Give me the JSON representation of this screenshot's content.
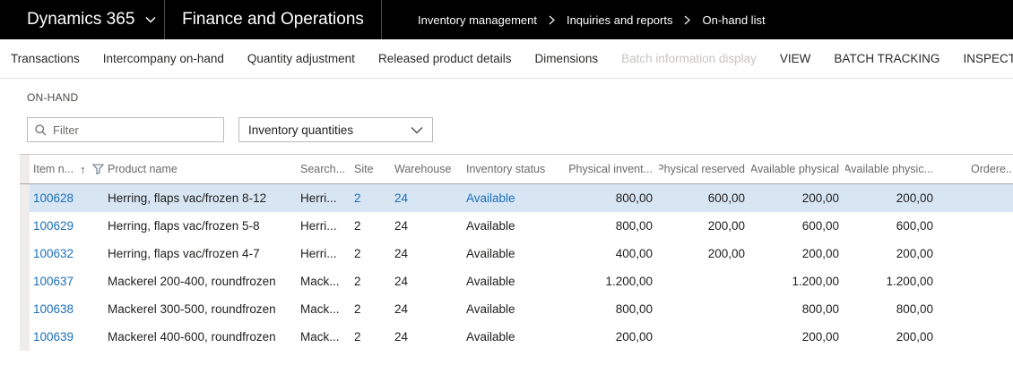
{
  "topbar": {
    "brand": "Dynamics 365",
    "app": "Finance and Operations",
    "breadcrumb": [
      "Inventory management",
      "Inquiries and reports",
      "On-hand list"
    ]
  },
  "menubar": {
    "items": [
      {
        "label": "Transactions",
        "disabled": false
      },
      {
        "label": "Intercompany on-hand",
        "disabled": false
      },
      {
        "label": "Quantity adjustment",
        "disabled": false
      },
      {
        "label": "Released product details",
        "disabled": false
      },
      {
        "label": "Dimensions",
        "disabled": false
      },
      {
        "label": "Batch information display",
        "disabled": true
      },
      {
        "label": "VIEW",
        "disabled": false
      },
      {
        "label": "BATCH TRACKING",
        "disabled": false
      },
      {
        "label": "INSPECT",
        "disabled": false
      }
    ]
  },
  "onhand": {
    "section_label": "ON-HAND",
    "filter_placeholder": "Filter",
    "view_selector_value": "Inventory quantities"
  },
  "icons": {
    "sort_ascending": "↑"
  },
  "grid": {
    "columns": [
      "Item n...",
      "Product name",
      "Search...",
      "Site",
      "Warehouse",
      "Inventory status",
      "Physical invent...",
      "Physical reserved",
      "Available physical",
      "Available physic...",
      "Ordere..."
    ],
    "rows": [
      {
        "item": "100628",
        "product": "Herring, flaps vac/frozen 8-12",
        "search": "Herri...",
        "site": "2",
        "warehouse": "24",
        "status": "Available",
        "physical_inventory": "800,00",
        "physical_reserved": "600,00",
        "available_physical": "200,00",
        "available_physical_2": "200,00",
        "ordered": ""
      },
      {
        "item": "100629",
        "product": "Herring, flaps vac/frozen 5-8",
        "search": "Herri...",
        "site": "2",
        "warehouse": "24",
        "status": "Available",
        "physical_inventory": "800,00",
        "physical_reserved": "200,00",
        "available_physical": "600,00",
        "available_physical_2": "600,00",
        "ordered": ""
      },
      {
        "item": "100632",
        "product": "Herring, flaps vac/frozen 4-7",
        "search": "Herri...",
        "site": "2",
        "warehouse": "24",
        "status": "Available",
        "physical_inventory": "400,00",
        "physical_reserved": "200,00",
        "available_physical": "200,00",
        "available_physical_2": "200,00",
        "ordered": ""
      },
      {
        "item": "100637",
        "product": "Mackerel 200-400, roundfrozen",
        "search": "Mack...",
        "site": "2",
        "warehouse": "24",
        "status": "Available",
        "physical_inventory": "1.200,00",
        "physical_reserved": "",
        "available_physical": "1.200,00",
        "available_physical_2": "1.200,00",
        "ordered": ""
      },
      {
        "item": "100638",
        "product": "Mackerel 300-500, roundfrozen",
        "search": "Mack...",
        "site": "2",
        "warehouse": "24",
        "status": "Available",
        "physical_inventory": "800,00",
        "physical_reserved": "",
        "available_physical": "800,00",
        "available_physical_2": "800,00",
        "ordered": ""
      },
      {
        "item": "100639",
        "product": "Mackerel 400-600, roundfrozen",
        "search": "Mack...",
        "site": "2",
        "warehouse": "24",
        "status": "Available",
        "physical_inventory": "200,00",
        "physical_reserved": "",
        "available_physical": "200,00",
        "available_physical_2": "200,00",
        "ordered": ""
      }
    ],
    "selected_row_index": 0
  },
  "colors": {
    "topbar_bg": "#000000",
    "link_blue": "#1a6fba",
    "selected_row_bg": "#d8e6f4",
    "disabled_text": "#c6c4c2"
  }
}
